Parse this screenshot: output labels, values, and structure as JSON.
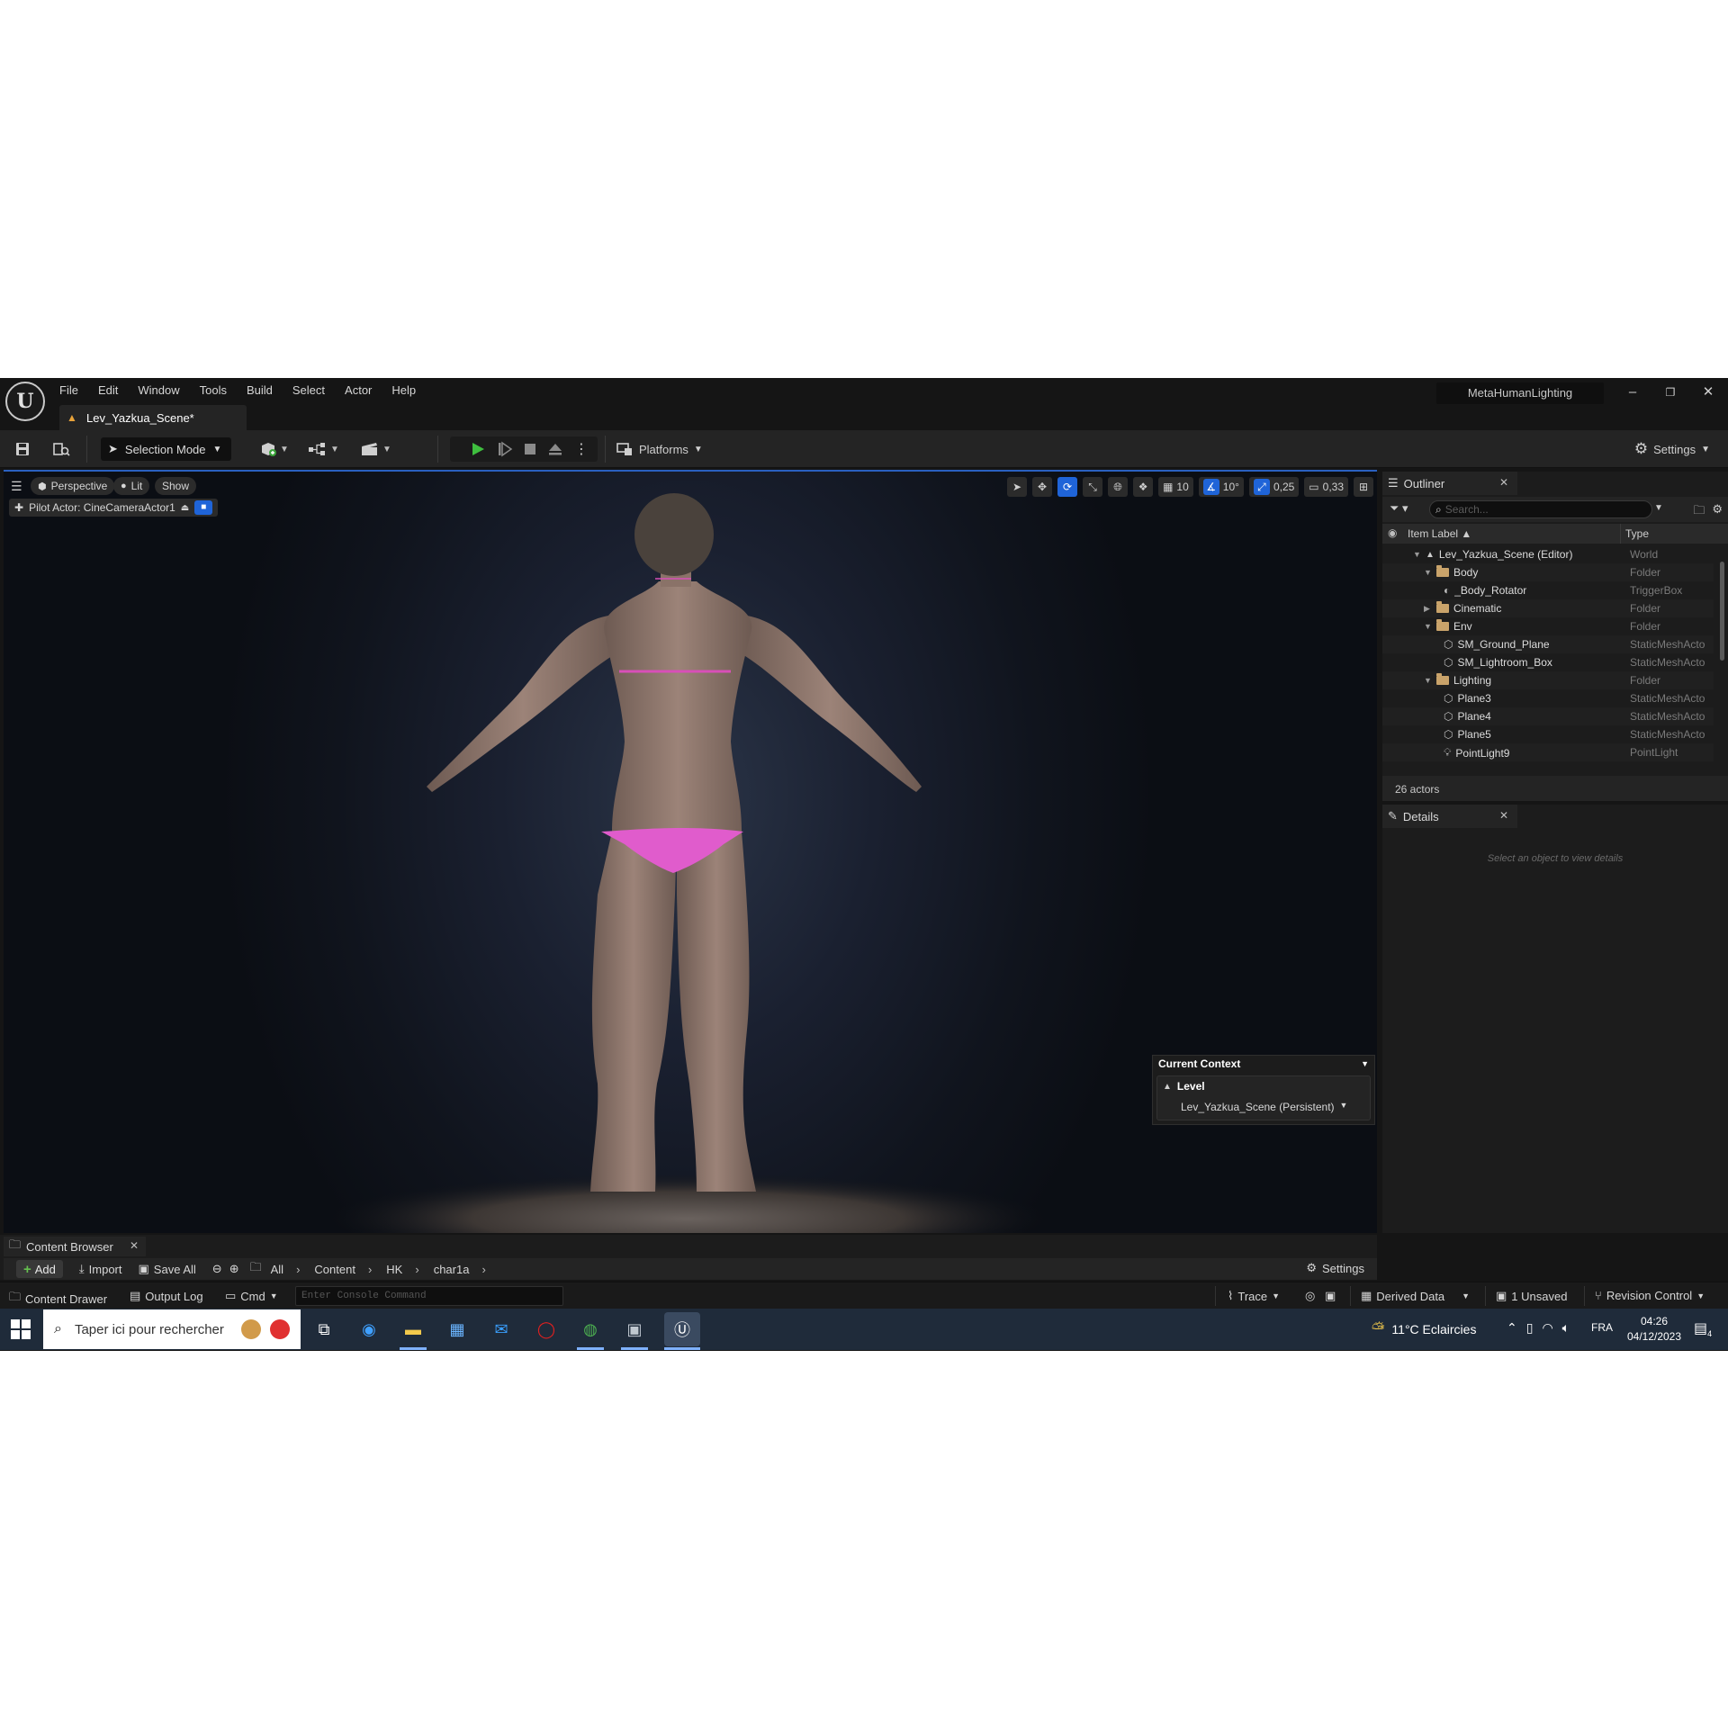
{
  "menu": [
    "File",
    "Edit",
    "Window",
    "Tools",
    "Build",
    "Select",
    "Actor",
    "Help"
  ],
  "project_name": "MetaHumanLighting",
  "level_tab": "Lev_Yazkua_Scene*",
  "toolbar": {
    "selection_mode": "Selection Mode",
    "platforms": "Platforms",
    "settings": "Settings"
  },
  "viewport": {
    "perspective": "Perspective",
    "lit": "Lit",
    "show": "Show",
    "pilot_actor": "Pilot Actor: CineCameraActor1",
    "grid_snap": "10",
    "rotation_snap": "10°",
    "scale_snap": "0,25",
    "camera_speed": "0,33",
    "context": {
      "title": "Current Context",
      "level_label": "Level",
      "level_value": "Lev_Yazkua_Scene (Persistent)"
    }
  },
  "outliner": {
    "tab": "Outliner",
    "search_placeholder": "Search...",
    "col_label": "Item Label ▲",
    "col_type": "Type",
    "rows": [
      {
        "label": "Lev_Yazkua_Scene (Editor)",
        "type": "World"
      },
      {
        "label": "Body",
        "type": "Folder"
      },
      {
        "label": "_Body_Rotator",
        "type": "TriggerBox"
      },
      {
        "label": "Cinematic",
        "type": "Folder"
      },
      {
        "label": "Env",
        "type": "Folder"
      },
      {
        "label": "SM_Ground_Plane",
        "type": "StaticMeshActo"
      },
      {
        "label": "SM_Lightroom_Box",
        "type": "StaticMeshActo"
      },
      {
        "label": "Lighting",
        "type": "Folder"
      },
      {
        "label": "Plane3",
        "type": "StaticMeshActo"
      },
      {
        "label": "Plane4",
        "type": "StaticMeshActo"
      },
      {
        "label": "Plane5",
        "type": "StaticMeshActo"
      },
      {
        "label": "PointLight9",
        "type": "PointLight"
      }
    ],
    "footer": "26 actors"
  },
  "details": {
    "tab": "Details",
    "empty": "Select an object to view details"
  },
  "content_browser": {
    "tab": "Content Browser",
    "add": "Add",
    "import": "Import",
    "save_all": "Save All",
    "breadcrumbs": [
      "All",
      "Content",
      "HK",
      "char1a"
    ],
    "settings": "Settings"
  },
  "statusbar": {
    "content_drawer": "Content Drawer",
    "output_log": "Output Log",
    "cmd": "Cmd",
    "console_placeholder": "Enter Console Command",
    "trace": "Trace",
    "derived_data": "Derived Data",
    "unsaved": "1 Unsaved",
    "revision_control": "Revision Control"
  },
  "taskbar": {
    "search_placeholder": "Taper ici pour rechercher",
    "weather": "11°C  Eclaircies",
    "lang": "FRA",
    "time": "04:26",
    "date": "04/12/2023",
    "notif_count": "4"
  }
}
